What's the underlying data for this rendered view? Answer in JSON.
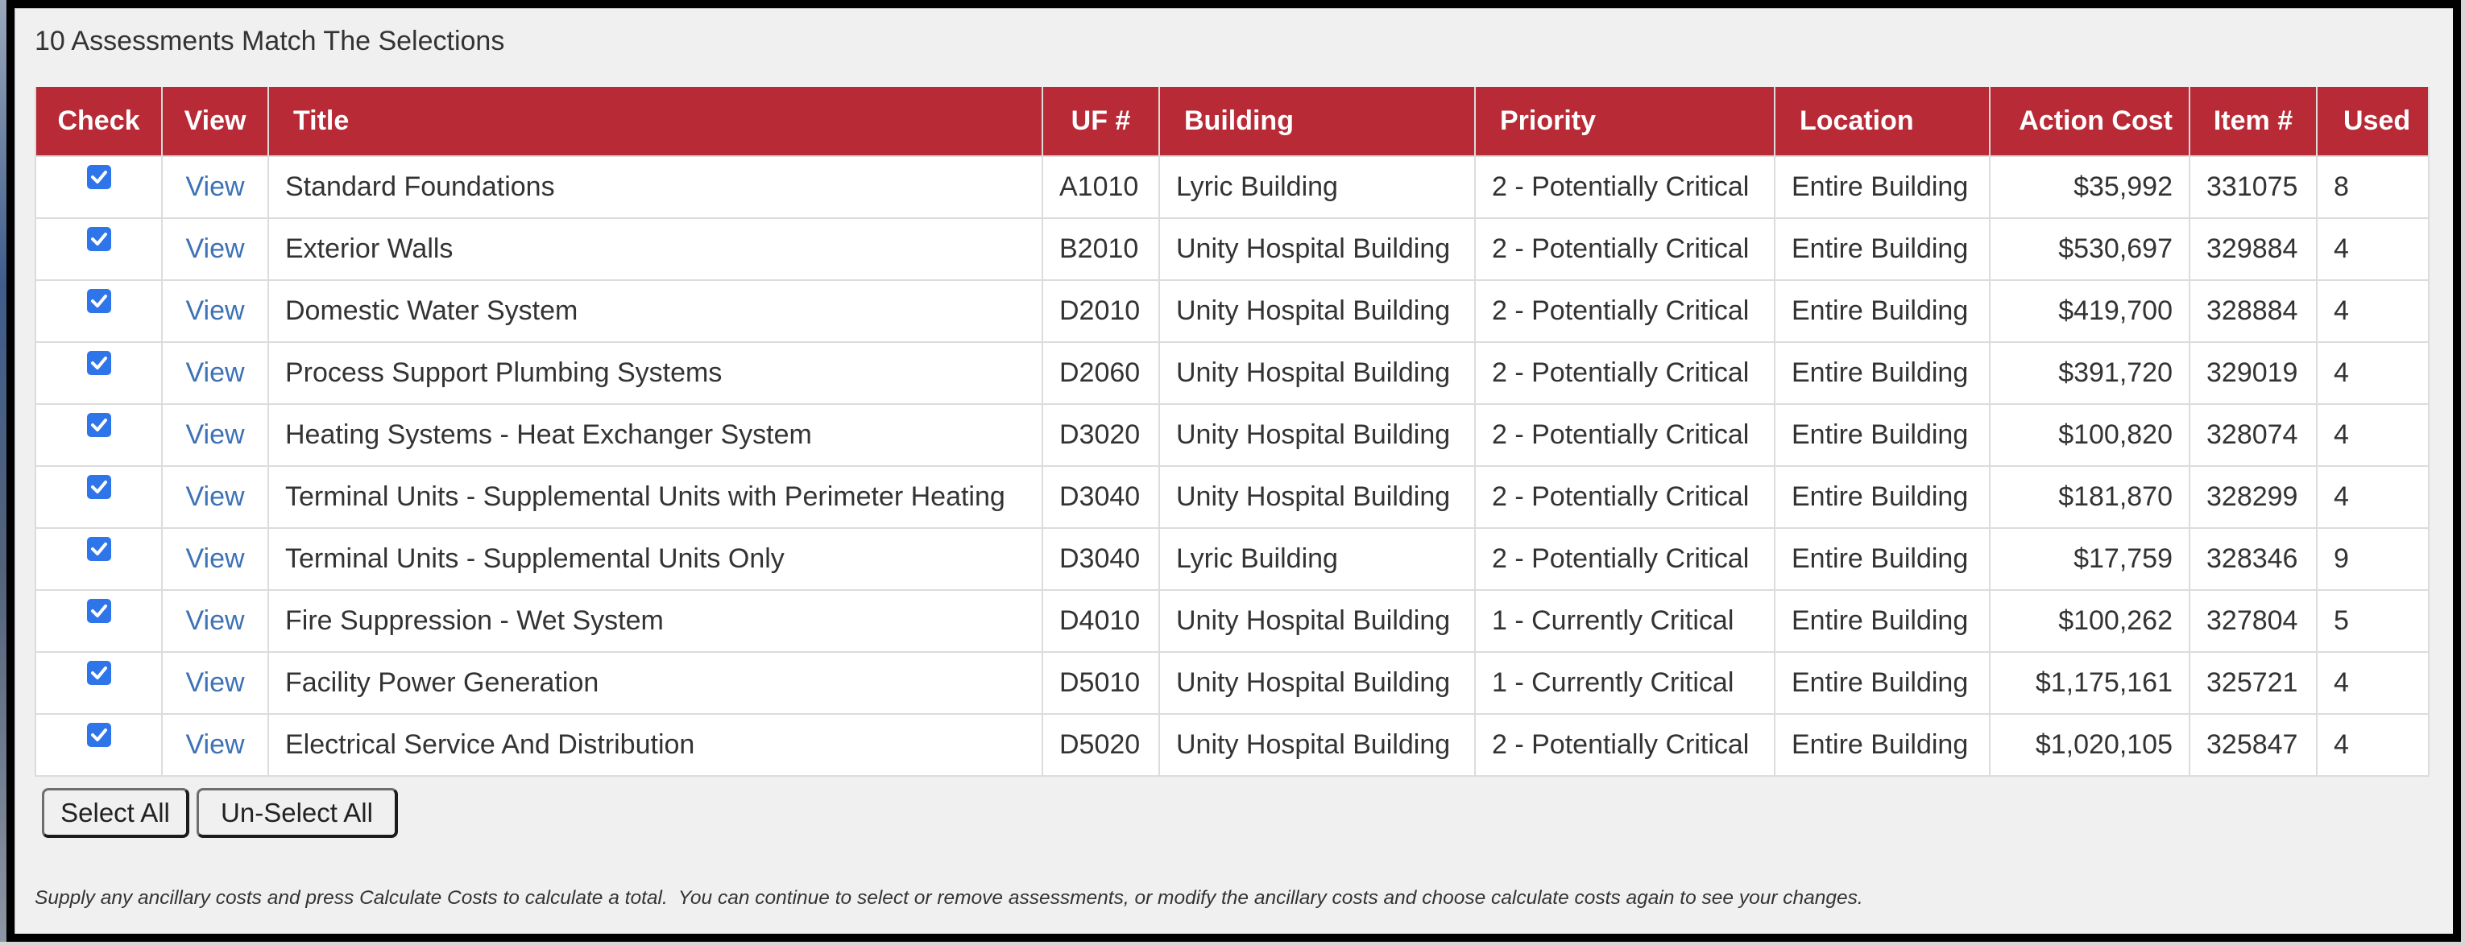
{
  "results": {
    "title": "10 Assessments Match The Selections"
  },
  "table": {
    "columns": [
      "Check",
      "View",
      "Title",
      "UF #",
      "Building",
      "Priority",
      "Location",
      "Action Cost",
      "Item #",
      "Used"
    ],
    "rows": [
      {
        "checked": true,
        "view": "View",
        "title": "Standard Foundations",
        "uf": "A1010",
        "building": "Lyric Building",
        "priority": "2 - Potentially Critical",
        "location": "Entire Building",
        "cost": "$35,992",
        "item": "331075",
        "used": "8"
      },
      {
        "checked": true,
        "view": "View",
        "title": "Exterior Walls",
        "uf": "B2010",
        "building": "Unity Hospital Building",
        "priority": "2 - Potentially Critical",
        "location": "Entire Building",
        "cost": "$530,697",
        "item": "329884",
        "used": "4"
      },
      {
        "checked": true,
        "view": "View",
        "title": "Domestic Water System",
        "uf": "D2010",
        "building": "Unity Hospital Building",
        "priority": "2 - Potentially Critical",
        "location": "Entire Building",
        "cost": "$419,700",
        "item": "328884",
        "used": "4"
      },
      {
        "checked": true,
        "view": "View",
        "title": "Process Support Plumbing Systems",
        "uf": "D2060",
        "building": "Unity Hospital Building",
        "priority": "2 - Potentially Critical",
        "location": "Entire Building",
        "cost": "$391,720",
        "item": "329019",
        "used": "4"
      },
      {
        "checked": true,
        "view": "View",
        "title": "Heating Systems - Heat Exchanger System",
        "uf": "D3020",
        "building": "Unity Hospital Building",
        "priority": "2 - Potentially Critical",
        "location": "Entire Building",
        "cost": "$100,820",
        "item": "328074",
        "used": "4"
      },
      {
        "checked": true,
        "view": "View",
        "title": "Terminal Units - Supplemental Units with Perimeter Heating",
        "uf": "D3040",
        "building": "Unity Hospital Building",
        "priority": "2 - Potentially Critical",
        "location": "Entire Building",
        "cost": "$181,870",
        "item": "328299",
        "used": "4"
      },
      {
        "checked": true,
        "view": "View",
        "title": "Terminal Units - Supplemental Units Only",
        "uf": "D3040",
        "building": "Lyric Building",
        "priority": "2 - Potentially Critical",
        "location": "Entire Building",
        "cost": "$17,759",
        "item": "328346",
        "used": "9"
      },
      {
        "checked": true,
        "view": "View",
        "title": "Fire Suppression - Wet System",
        "uf": "D4010",
        "building": "Unity Hospital Building",
        "priority": "1 - Currently Critical",
        "location": "Entire Building",
        "cost": "$100,262",
        "item": "327804",
        "used": "5"
      },
      {
        "checked": true,
        "view": "View",
        "title": "Facility Power Generation",
        "uf": "D5010",
        "building": "Unity Hospital Building",
        "priority": "1 - Currently Critical",
        "location": "Entire Building",
        "cost": "$1,175,161",
        "item": "325721",
        "used": "4"
      },
      {
        "checked": true,
        "view": "View",
        "title": "Electrical Service And Distribution",
        "uf": "D5020",
        "building": "Unity Hospital Building",
        "priority": "2 - Potentially Critical",
        "location": "Entire Building",
        "cost": "$1,020,105",
        "item": "325847",
        "used": "4"
      }
    ]
  },
  "buttons": {
    "select_all": "Select All",
    "unselect_all": "Un-Select All"
  },
  "note": "Supply any ancillary costs and press Calculate Costs to calculate a total.  You can continue to select or remove assessments, or modify the ancillary costs and choose calculate costs again to see your changes.",
  "colors": {
    "header_bg": "#b72a36",
    "link": "#3d72b6",
    "checkbox": "#2f75ea"
  }
}
